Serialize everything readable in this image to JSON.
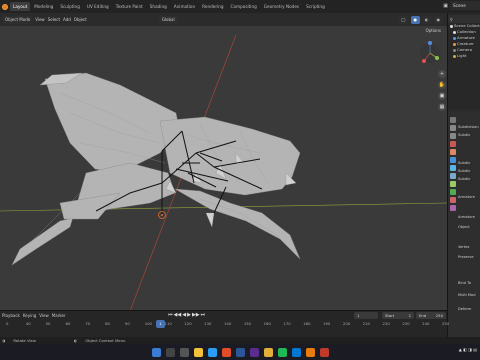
{
  "workspace_tabs": [
    "Layout",
    "Modeling",
    "Sculpting",
    "UV Editing",
    "Texture Paint",
    "Shading",
    "Animation",
    "Rendering",
    "Compositing",
    "Geometry Nodes",
    "Scripting"
  ],
  "scene_name": "Scene",
  "viewport": {
    "mode": "Object Mode",
    "menu": [
      "View",
      "Select",
      "Add",
      "Object"
    ],
    "transform_orientation": "Global",
    "options_label": "Options"
  },
  "outliner": {
    "title": "Scene Collection",
    "rows": [
      "Scene Collection",
      "Collection",
      "Armature",
      "Creature",
      "Camera",
      "Light"
    ]
  },
  "properties": {
    "labels": [
      "Subdivision",
      "Subdiv",
      "Subdiv",
      "Subdiv",
      "Subdiv",
      "Armature",
      "Armature",
      "Object",
      "Vertex",
      "Preserve",
      "Bind To",
      "Multi Mod",
      "Deform"
    ]
  },
  "timeline": {
    "menu": [
      "Playback",
      "Keying",
      "View",
      "Marker"
    ],
    "current_frame": "1",
    "start_label": "Start",
    "start_value": "1",
    "end_label": "End",
    "end_value": "250",
    "ruler_ticks": [
      "0",
      "40",
      "50",
      "60",
      "70",
      "80",
      "90",
      "100",
      "110",
      "120",
      "130",
      "140",
      "150",
      "160",
      "170",
      "180",
      "190",
      "200",
      "210",
      "220",
      "230",
      "240",
      "250"
    ]
  },
  "status_bar": {
    "left": "Rotate View",
    "middle": "Object Context Menu"
  },
  "colors": {
    "accent": "#4772b3",
    "viewport_bg": "#3a3a3a",
    "x_axis": "#b5493d",
    "y_axis": "#8fa83a",
    "mesh": "#b4b4b4",
    "origin": "#e8702a"
  }
}
